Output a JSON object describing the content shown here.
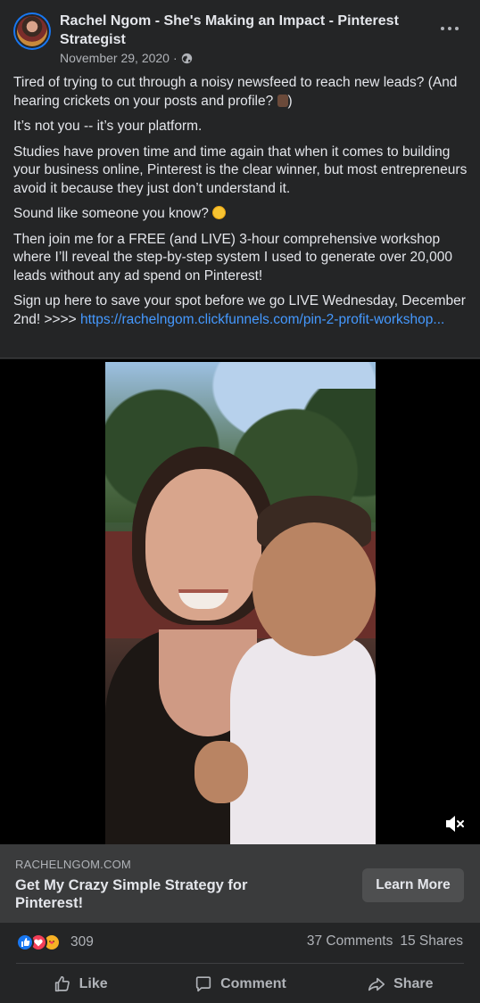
{
  "post": {
    "author": "Rachel Ngom - She's Making an Impact - Pinterest Strategist",
    "date": "November 29, 2020",
    "privacy_icon": "globe-icon",
    "more_icon": "more-options-icon",
    "paragraphs": [
      "Tired of trying to cut through a noisy newsfeed to reach new leads? (And hearing crickets on your posts and profile?",
      "It’s not you -- it’s your platform.",
      "Studies have proven time and time again that when it comes to building your business online, Pinterest is the clear winner, but most entrepreneurs avoid it because they just don’t understand it.",
      "Sound like someone you know?",
      "Then join me for a FREE (and LIVE) 3-hour comprehensive workshop where I’ll reveal the step-by-step system I used to generate over 20,000 leads without any ad spend on Pinterest!",
      "Sign up here to save your spot before we go LIVE Wednesday, December 2nd! >>>> "
    ],
    "paragraph1_suffix": ")",
    "link_text": "https://rachelngom.clickfunnels.com/pin-2-profit-workshop..."
  },
  "link_preview": {
    "domain": "RACHELNGOM.COM",
    "title": "Get My Crazy Simple Strategy for Pinterest!",
    "cta": "Learn More"
  },
  "engagement": {
    "reaction_count": "309",
    "comments": "37 Comments",
    "shares": "15 Shares"
  },
  "actions": {
    "like": "Like",
    "comment": "Comment",
    "share": "Share"
  },
  "colors": {
    "background": "#242526",
    "link": "#4599ff",
    "card": "#3a3b3c",
    "like_blue": "#1877f2",
    "love_red": "#f33e58"
  }
}
